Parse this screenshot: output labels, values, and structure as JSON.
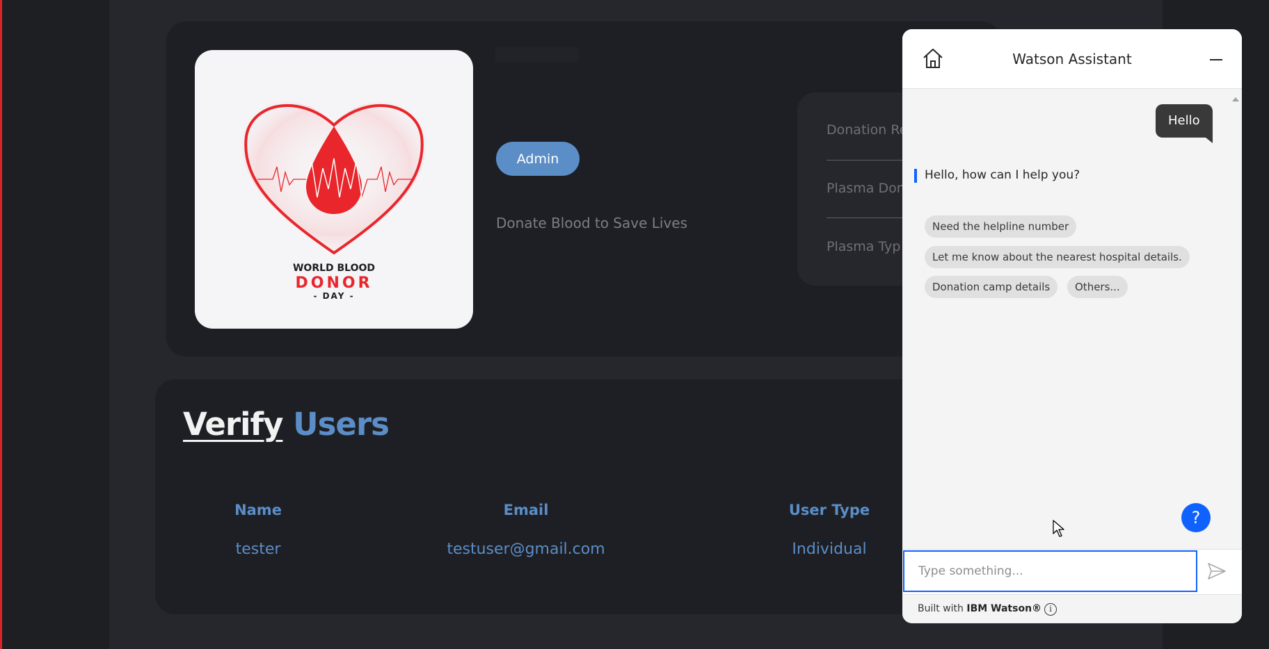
{
  "profile": {
    "role_badge": "Admin",
    "tagline": "Donate Blood to Save Lives",
    "logo": {
      "line1": "WORLD BLOOD",
      "line2": "DONOR",
      "line3": "- DAY -"
    },
    "stats": [
      "Donation Re",
      "Plasma Don",
      "Plasma Typ"
    ]
  },
  "verify": {
    "title_word1": "Verify",
    "title_word2": "Users",
    "columns": [
      "Name",
      "Email",
      "User Type"
    ],
    "rows": [
      {
        "name": "tester",
        "email": "testuser@gmail.com",
        "user_type": "Individual"
      }
    ]
  },
  "chat": {
    "title": "Watson Assistant",
    "user_message": "Hello",
    "bot_message": "Hello, how can I help you?",
    "options": [
      "Need the helpline number",
      "Let me know about the nearest hospital details.",
      "Donation camp details",
      "Others..."
    ],
    "input_placeholder": "Type something...",
    "help_symbol": "?",
    "footer_prefix": "Built with",
    "footer_brand": "IBM Watson®",
    "info_symbol": "i"
  },
  "colors": {
    "accent_blue": "#5b8ec7",
    "watson_blue": "#0f62fe",
    "brand_red": "#d9252b"
  },
  "icons": {
    "home": "home-icon",
    "minimize": "minimize-icon",
    "send": "send-icon",
    "help": "help-icon",
    "info": "info-icon"
  }
}
